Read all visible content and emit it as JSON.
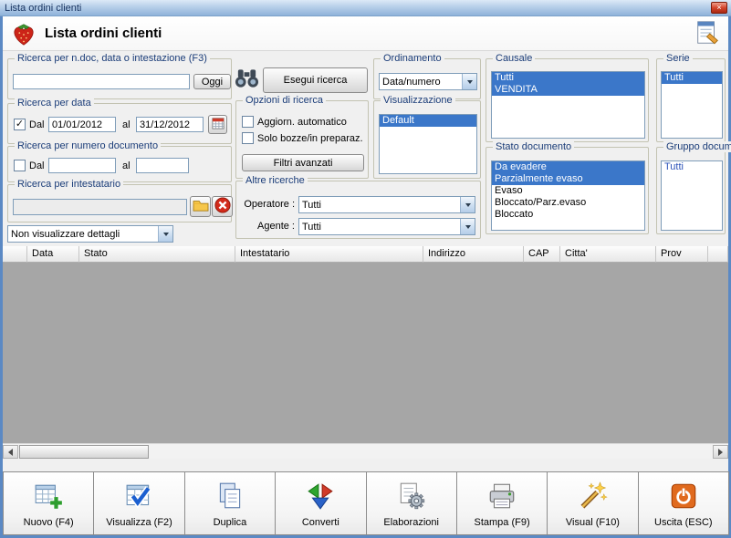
{
  "window": {
    "title": "Lista ordini clienti"
  },
  "header": {
    "title": "Lista ordini clienti"
  },
  "colors": {
    "selection_blue": "#3b77c9",
    "titlebar_blue": "#b7cfe9",
    "close_button_red": "#d4452c",
    "table_body_gray": "#a6a6a6"
  },
  "icons": {
    "logo": "strawberry-icon",
    "header_right": "report-icon",
    "search": "binoculars-icon",
    "calendar": "calendar-icon",
    "lookup": "folder-open-icon",
    "clear": "red-delete-icon",
    "close": "close-x-icon"
  },
  "search": {
    "doc_group_label": "Ricerca per n.doc, data o intestazione (F3)",
    "doc_value": "",
    "oggi_button": "Oggi",
    "esegui_button": "Esegui ricerca",
    "date_group_label": "Ricerca per data",
    "date_dal_label": "Dal",
    "date_dal_value": "01/01/2012",
    "date_al_label": "al",
    "date_al_value": "31/12/2012",
    "num_group_label": "Ricerca per numero documento",
    "num_dal_label": "Dal",
    "num_dal_value": "",
    "num_al_label": "al",
    "num_al_value": "",
    "intestatario_group_label": "Ricerca per intestatario",
    "intestatario_value": "",
    "dettagli_value": "Non visualizzare dettagli"
  },
  "opzioni": {
    "group_label": "Opzioni di ricerca",
    "aggiorn_label": "Aggiorn. automatico",
    "bozze_label": "Solo bozze/in preparaz.",
    "filtri_button": "Filtri avanzati"
  },
  "ordinamento": {
    "group_label": "Ordinamento",
    "value": "Data/numero"
  },
  "visualizzazione": {
    "group_label": "Visualizzazione",
    "items": [
      "Default"
    ]
  },
  "altre": {
    "group_label": "Altre ricerche",
    "operatore_label": "Operatore :",
    "operatore_value": "Tutti",
    "agente_label": "Agente :",
    "agente_value": "Tutti"
  },
  "causale": {
    "group_label": "Causale",
    "items": [
      "Tutti",
      "VENDITA"
    ]
  },
  "serie": {
    "group_label": "Serie",
    "items": [
      "Tutti"
    ]
  },
  "stato": {
    "group_label": "Stato documento",
    "items": [
      "Da evadere",
      "Parzialmente evaso",
      "Evaso",
      "Bloccato/Parz.evaso",
      "Bloccato"
    ]
  },
  "gruppo": {
    "group_label": "Gruppo documento",
    "items": [
      "Tutti"
    ]
  },
  "table": {
    "columns": [
      "Data",
      "Stato",
      "Intestatario",
      "Indirizzo",
      "CAP",
      "Citta'",
      "Prov"
    ]
  },
  "actions": [
    {
      "label": "Nuovo (F4)",
      "icon": "new-grid-plus-icon"
    },
    {
      "label": "Visualizza (F2)",
      "icon": "view-grid-check-icon"
    },
    {
      "label": "Duplica",
      "icon": "duplicate-pages-icon"
    },
    {
      "label": "Converti",
      "icon": "convert-arrows-icon"
    },
    {
      "label": "Elaborazioni",
      "icon": "process-gear-icon"
    },
    {
      "label": "Stampa (F9)",
      "icon": "printer-icon"
    },
    {
      "label": "Visual (F10)",
      "icon": "magic-wand-icon"
    },
    {
      "label": "Uscita (ESC)",
      "icon": "exit-power-icon"
    }
  ]
}
